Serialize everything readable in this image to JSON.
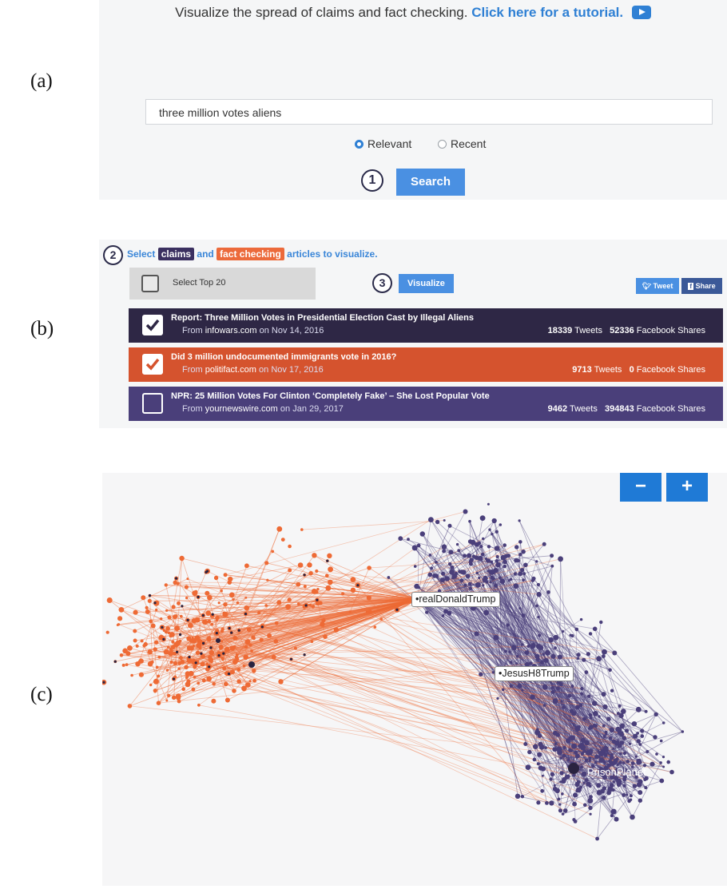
{
  "panel_labels": {
    "a": "(a)",
    "b": "(b)",
    "c": "(c)"
  },
  "panel_a": {
    "tagline_text": "Visualize the spread of claims and fact checking.",
    "tutorial_link": "Click here for a tutorial.",
    "tutorial_icon": "play-icon",
    "search_value": "three million votes aliens",
    "radio_options": [
      {
        "label": "Relevant",
        "selected": true
      },
      {
        "label": "Recent",
        "selected": false
      }
    ],
    "step": "1",
    "search_button": "Search"
  },
  "panel_b": {
    "step": "2",
    "instr_select": "Select",
    "tag_claims": "claims",
    "instr_and": "and",
    "tag_fact_checking": "fact checking",
    "instr_tail": "articles to visualize.",
    "select_top_label": "Select Top 20",
    "step_visualize": "3",
    "visualize_button": "Visualize",
    "tweet_button": "Tweet",
    "share_button": "Share",
    "articles": [
      {
        "title": "Report: Three Million Votes in Presidential Election Cast by Illegal Aliens",
        "from": "From",
        "source": "infowars.com",
        "on": "on",
        "date": "Nov 14, 2016",
        "tweets": "18339",
        "tweets_label": "Tweets",
        "shares": "52336",
        "shares_label": "Facebook Shares",
        "checked": true,
        "color": "#2e2745"
      },
      {
        "title": "Did 3 million undocumented immigrants vote in 2016?",
        "from": "From",
        "source": "politifact.com",
        "on": "on",
        "date": "Nov 17, 2016",
        "tweets": "9713",
        "tweets_label": "Tweets",
        "shares": "0",
        "shares_label": "Facebook Shares",
        "checked": true,
        "color": "#d5532e"
      },
      {
        "title": "NPR: 25 Million Votes For Clinton ‘Completely Fake’ – She Lost Popular Vote",
        "from": "From",
        "source": "yournewswire.com",
        "on": "on",
        "date": "Jan 29, 2017",
        "tweets": "9462",
        "tweets_label": "Tweets",
        "shares": "394843",
        "shares_label": "Facebook Shares",
        "checked": false,
        "color": "#4a3f7a"
      }
    ]
  },
  "panel_c": {
    "zoom_out": "−",
    "zoom_in": "+",
    "node_labels": [
      "realDonaldTrump",
      "JesusH8Trump",
      "PrisonPlanet"
    ],
    "colors": {
      "claim": "#4a3f7a",
      "fact_check": "#ee6a35",
      "hub": "#2a2340"
    }
  }
}
